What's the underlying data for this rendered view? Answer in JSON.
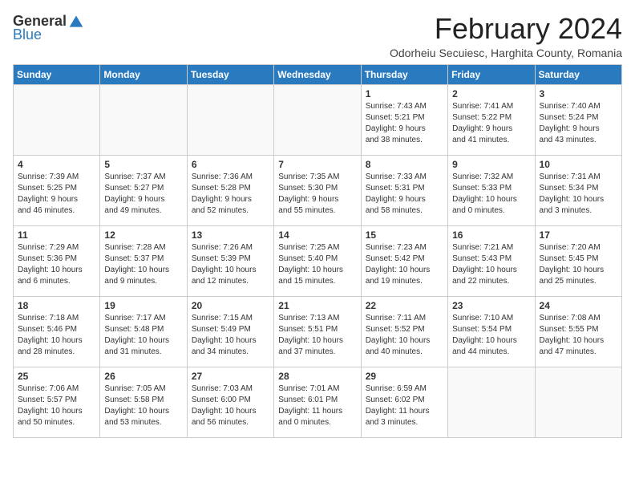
{
  "logo": {
    "general": "General",
    "blue": "Blue"
  },
  "header": {
    "month": "February 2024",
    "location": "Odorheiu Secuiesc, Harghita County, Romania"
  },
  "weekdays": [
    "Sunday",
    "Monday",
    "Tuesday",
    "Wednesday",
    "Thursday",
    "Friday",
    "Saturday"
  ],
  "weeks": [
    [
      {
        "day": "",
        "info": ""
      },
      {
        "day": "",
        "info": ""
      },
      {
        "day": "",
        "info": ""
      },
      {
        "day": "",
        "info": ""
      },
      {
        "day": "1",
        "info": "Sunrise: 7:43 AM\nSunset: 5:21 PM\nDaylight: 9 hours\nand 38 minutes."
      },
      {
        "day": "2",
        "info": "Sunrise: 7:41 AM\nSunset: 5:22 PM\nDaylight: 9 hours\nand 41 minutes."
      },
      {
        "day": "3",
        "info": "Sunrise: 7:40 AM\nSunset: 5:24 PM\nDaylight: 9 hours\nand 43 minutes."
      }
    ],
    [
      {
        "day": "4",
        "info": "Sunrise: 7:39 AM\nSunset: 5:25 PM\nDaylight: 9 hours\nand 46 minutes."
      },
      {
        "day": "5",
        "info": "Sunrise: 7:37 AM\nSunset: 5:27 PM\nDaylight: 9 hours\nand 49 minutes."
      },
      {
        "day": "6",
        "info": "Sunrise: 7:36 AM\nSunset: 5:28 PM\nDaylight: 9 hours\nand 52 minutes."
      },
      {
        "day": "7",
        "info": "Sunrise: 7:35 AM\nSunset: 5:30 PM\nDaylight: 9 hours\nand 55 minutes."
      },
      {
        "day": "8",
        "info": "Sunrise: 7:33 AM\nSunset: 5:31 PM\nDaylight: 9 hours\nand 58 minutes."
      },
      {
        "day": "9",
        "info": "Sunrise: 7:32 AM\nSunset: 5:33 PM\nDaylight: 10 hours\nand 0 minutes."
      },
      {
        "day": "10",
        "info": "Sunrise: 7:31 AM\nSunset: 5:34 PM\nDaylight: 10 hours\nand 3 minutes."
      }
    ],
    [
      {
        "day": "11",
        "info": "Sunrise: 7:29 AM\nSunset: 5:36 PM\nDaylight: 10 hours\nand 6 minutes."
      },
      {
        "day": "12",
        "info": "Sunrise: 7:28 AM\nSunset: 5:37 PM\nDaylight: 10 hours\nand 9 minutes."
      },
      {
        "day": "13",
        "info": "Sunrise: 7:26 AM\nSunset: 5:39 PM\nDaylight: 10 hours\nand 12 minutes."
      },
      {
        "day": "14",
        "info": "Sunrise: 7:25 AM\nSunset: 5:40 PM\nDaylight: 10 hours\nand 15 minutes."
      },
      {
        "day": "15",
        "info": "Sunrise: 7:23 AM\nSunset: 5:42 PM\nDaylight: 10 hours\nand 19 minutes."
      },
      {
        "day": "16",
        "info": "Sunrise: 7:21 AM\nSunset: 5:43 PM\nDaylight: 10 hours\nand 22 minutes."
      },
      {
        "day": "17",
        "info": "Sunrise: 7:20 AM\nSunset: 5:45 PM\nDaylight: 10 hours\nand 25 minutes."
      }
    ],
    [
      {
        "day": "18",
        "info": "Sunrise: 7:18 AM\nSunset: 5:46 PM\nDaylight: 10 hours\nand 28 minutes."
      },
      {
        "day": "19",
        "info": "Sunrise: 7:17 AM\nSunset: 5:48 PM\nDaylight: 10 hours\nand 31 minutes."
      },
      {
        "day": "20",
        "info": "Sunrise: 7:15 AM\nSunset: 5:49 PM\nDaylight: 10 hours\nand 34 minutes."
      },
      {
        "day": "21",
        "info": "Sunrise: 7:13 AM\nSunset: 5:51 PM\nDaylight: 10 hours\nand 37 minutes."
      },
      {
        "day": "22",
        "info": "Sunrise: 7:11 AM\nSunset: 5:52 PM\nDaylight: 10 hours\nand 40 minutes."
      },
      {
        "day": "23",
        "info": "Sunrise: 7:10 AM\nSunset: 5:54 PM\nDaylight: 10 hours\nand 44 minutes."
      },
      {
        "day": "24",
        "info": "Sunrise: 7:08 AM\nSunset: 5:55 PM\nDaylight: 10 hours\nand 47 minutes."
      }
    ],
    [
      {
        "day": "25",
        "info": "Sunrise: 7:06 AM\nSunset: 5:57 PM\nDaylight: 10 hours\nand 50 minutes."
      },
      {
        "day": "26",
        "info": "Sunrise: 7:05 AM\nSunset: 5:58 PM\nDaylight: 10 hours\nand 53 minutes."
      },
      {
        "day": "27",
        "info": "Sunrise: 7:03 AM\nSunset: 6:00 PM\nDaylight: 10 hours\nand 56 minutes."
      },
      {
        "day": "28",
        "info": "Sunrise: 7:01 AM\nSunset: 6:01 PM\nDaylight: 11 hours\nand 0 minutes."
      },
      {
        "day": "29",
        "info": "Sunrise: 6:59 AM\nSunset: 6:02 PM\nDaylight: 11 hours\nand 3 minutes."
      },
      {
        "day": "",
        "info": ""
      },
      {
        "day": "",
        "info": ""
      }
    ]
  ]
}
